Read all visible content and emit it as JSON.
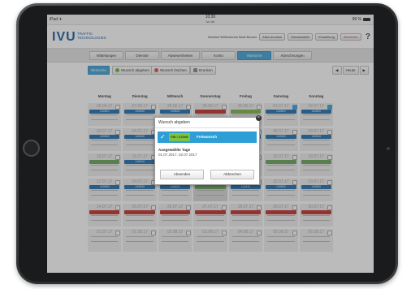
{
  "status_bar": {
    "left": "iPad ✈",
    "time": "10:30",
    "url": "ivu.de",
    "battery": "99 %"
  },
  "header": {
    "logo": "IVU",
    "logo_sub": "TRAFFIC TECHNOLOGIES",
    "user_label": "Herzlich Willkommen Beat Boozer",
    "buttons": [
      "Alles drucken",
      "Dienstanteile",
      "Einstellung",
      "Abmelden"
    ],
    "help": "?"
  },
  "tabs": [
    "Mitteilungen",
    "Dienste",
    "Abwesenheiten",
    "Konto",
    "Wünsche",
    "Abrechnungen"
  ],
  "active_tab": "Wünsche",
  "actions": {
    "wishes": "Wünsche",
    "submit": "Wunsch abgeben",
    "delete": "Wunsch löschen",
    "print": "Drucken",
    "prev": "◀",
    "today": "Heute",
    "next": "▶"
  },
  "days": [
    "Montag",
    "Dienstag",
    "Mittwoch",
    "Donnerstag",
    "Freitag",
    "Samstag",
    "Sonntag"
  ],
  "weeks": [
    {
      "dates": [
        "26.06.17",
        "27.06.17",
        "28.06.17",
        "29.06.17",
        "30.06.17",
        "01.07.17",
        "02.07.17"
      ],
      "bars": [
        [
          "b",
          "140810"
        ],
        [
          "b",
          "140840"
        ],
        [
          "b",
          "140820"
        ],
        [
          "r",
          ""
        ],
        [
          "g",
          ""
        ],
        [
          "b",
          "140810"
        ],
        [
          "b",
          "140820"
        ]
      ],
      "checked": [
        false,
        false,
        false,
        false,
        false,
        true,
        true
      ]
    },
    {
      "dates": [
        "03.07.17",
        "04.07.17",
        "05.07.17",
        "06.07.17",
        "07.07.17",
        "08.07.17",
        "09.07.17"
      ],
      "bars": [
        [
          "b",
          "140830"
        ],
        [
          "b",
          "140840"
        ],
        [
          "b",
          "140810"
        ],
        [
          "none",
          ""
        ],
        [
          "b",
          "140810"
        ],
        [
          "b",
          "140830"
        ],
        [
          "b",
          "140810"
        ]
      ],
      "checked": [
        false,
        false,
        false,
        false,
        false,
        false,
        false
      ]
    },
    {
      "dates": [
        "10.07.17",
        "11.07.17",
        "12.07.17",
        "13.07.17",
        "14.07.17",
        "15.07.17",
        "16.07.17"
      ],
      "bars": [
        [
          "gr",
          ""
        ],
        [
          "b",
          "140810"
        ],
        [
          "none",
          ""
        ],
        [
          "none",
          ""
        ],
        [
          "none",
          ""
        ],
        [
          "gr",
          ""
        ],
        [
          "gr",
          ""
        ]
      ],
      "checked": [
        false,
        false,
        false,
        false,
        false,
        false,
        false
      ]
    },
    {
      "dates": [
        "17.07.17",
        "18.07.17",
        "19.07.17",
        "20.07.17",
        "21.07.17",
        "22.07.17",
        "23.07.17"
      ],
      "bars": [
        [
          "b",
          "140830"
        ],
        [
          "b",
          "140830"
        ],
        [
          "b",
          "140840"
        ],
        [
          "gr",
          ""
        ],
        [
          "b",
          "140810"
        ],
        [
          "b",
          "140820"
        ],
        [
          "b",
          "140820"
        ]
      ],
      "checked": [
        false,
        false,
        false,
        false,
        false,
        false,
        false
      ]
    },
    {
      "dates": [
        "24.07.17",
        "25.07.17",
        "26.07.17",
        "27.07.17",
        "28.07.17",
        "29.07.17",
        "30.07.17"
      ],
      "bars": [
        [
          "r",
          ""
        ],
        [
          "r",
          ""
        ],
        [
          "r",
          ""
        ],
        [
          "r",
          ""
        ],
        [
          "r",
          ""
        ],
        [
          "r",
          ""
        ],
        [
          "r",
          ""
        ]
      ],
      "checked": [
        false,
        false,
        false,
        false,
        false,
        false,
        false
      ]
    },
    {
      "dates": [
        "31.07.17",
        "01.08.17",
        "02.08.17",
        "03.08.17",
        "04.08.17",
        "05.08.17",
        "06.08.17"
      ],
      "bars": [
        [
          "none",
          ""
        ],
        [
          "none",
          ""
        ],
        [
          "none",
          ""
        ],
        [
          "none",
          ""
        ],
        [
          "none",
          ""
        ],
        [
          "none",
          ""
        ],
        [
          "none",
          ""
        ]
      ],
      "checked": [
        false,
        false,
        false,
        false,
        false,
        false,
        false
      ]
    }
  ],
  "modal": {
    "title": "Wunsch abgeben",
    "close": "×",
    "code": "FW / CONG",
    "label": "Freiwunsch",
    "section": "Ausgewählte Tage",
    "selected": "01.07.2017, 02.07.2017",
    "submit": "Absenden",
    "cancel": "Abbrechen"
  },
  "colors": {
    "accent": "#3fa2d8",
    "shift_blue": "#1f6fb0",
    "red": "#c4302b",
    "green": "#7fb24a"
  }
}
